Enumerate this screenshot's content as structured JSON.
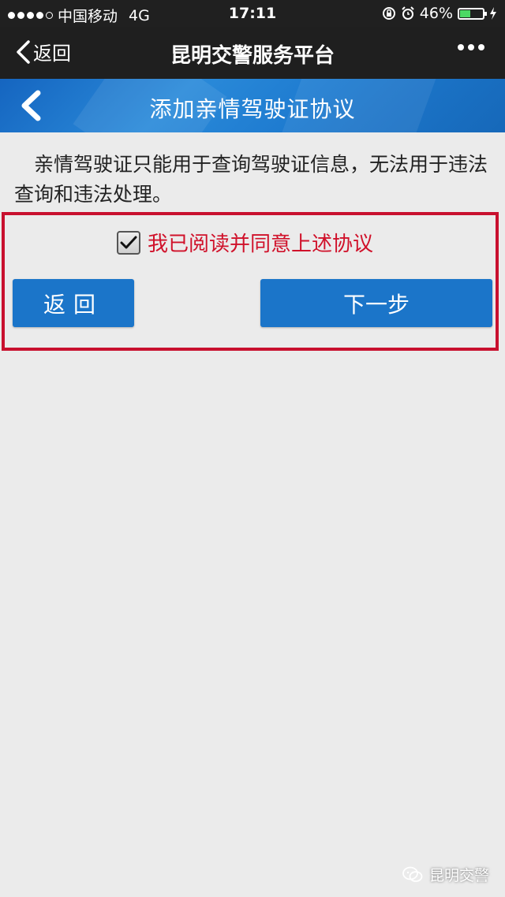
{
  "status_bar": {
    "carrier": "中国移动",
    "network": "4G",
    "time": "17:11",
    "battery": "46%",
    "battery_level": 0.46
  },
  "nav": {
    "back_label": "返回",
    "title": "昆明交警服务平台"
  },
  "page": {
    "title": "添加亲情驾驶证协议",
    "description": "亲情驾驶证只能用于查询驾驶证信息，无法用于违法查询和违法处理。",
    "agree_label": "我已阅读并同意上述协议",
    "agree_checked": true,
    "back_button": "返回",
    "next_button": "下一步"
  },
  "watermark": {
    "text": "昆明交警"
  },
  "colors": {
    "accent_blue": "#1b75c9",
    "highlight_red": "#c8102e",
    "agree_text_red": "#d0112a"
  }
}
